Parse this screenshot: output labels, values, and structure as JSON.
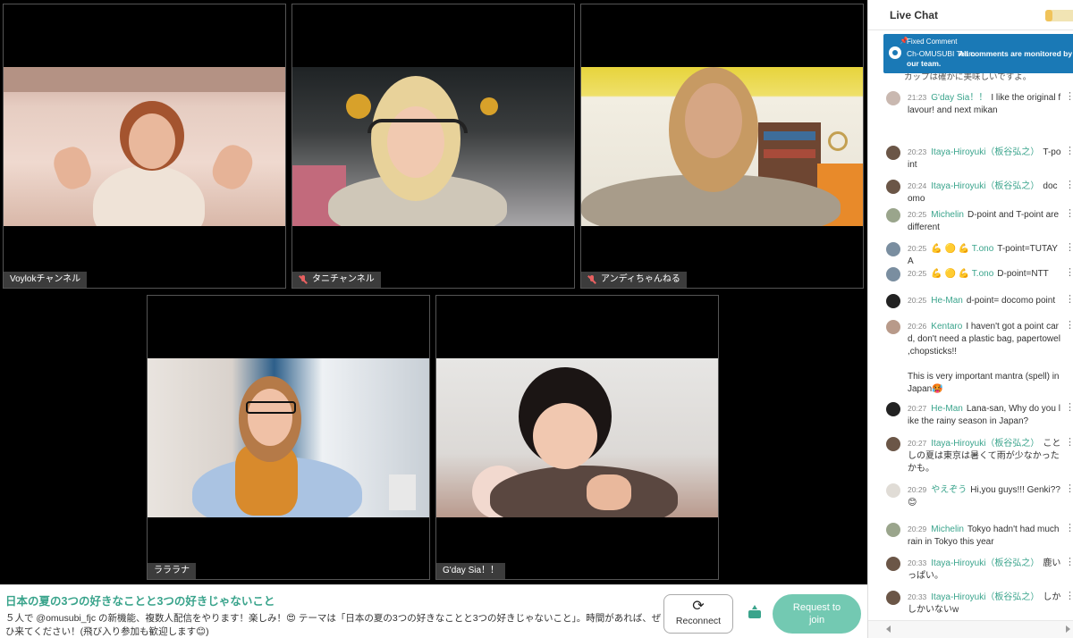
{
  "stage": {
    "tiles": [
      {
        "name": "Voylokチャンネル",
        "muted": false
      },
      {
        "name": "タニチャンネル",
        "muted": true
      },
      {
        "name": "アンディちゃんねる",
        "muted": true
      },
      {
        "name": "ラララナ",
        "muted": false
      },
      {
        "name": "G'day Sia！！",
        "muted": false
      }
    ]
  },
  "info": {
    "title": "日本の夏の3つの好きなことと3つの好きじゃないこと",
    "description": "５人で @omusubi_fjc の新機能、複数人配信をやります！楽しみ！😍 テーマは「日本の夏の3つの好きなことと3つの好きじゃないこと」。時間があれば、ぜひ来てください！(飛び入り参加も歓迎します😊)",
    "reconnect_label": "Reconnect",
    "join_label": "Request to join",
    "reconnect_icon": "refresh-icon",
    "share_icon": "share-icon"
  },
  "chat": {
    "title": "Live Chat",
    "pinned": {
      "label": "Fixed Comment",
      "author": "Ch-OMUSUBI Team",
      "text": "All comments are monitored by our team."
    },
    "ghost_text": "カップは確かに美味しいですよ。",
    "messages": [
      {
        "time": "21:23",
        "author": "G'day Sia！！",
        "text": "I like the original flavour! and next mikan",
        "avatar": "#c9b8b0"
      },
      {
        "time": "20:23",
        "author": "Itaya-Hiroyuki（板谷弘之）",
        "text": "T-point",
        "avatar": "#6b5647"
      },
      {
        "time": "20:24",
        "author": "Itaya-Hiroyuki（板谷弘之）",
        "text": "docomo",
        "avatar": "#6b5647"
      },
      {
        "time": "20:25",
        "author": "Michelin",
        "text": "D-point and T-point are different",
        "avatar": "#9aa58c"
      },
      {
        "time": "20:25",
        "author": "💪 🟡 💪 T.ono",
        "text": "T-point=TUTAYA",
        "avatar": "#7a8ea0"
      },
      {
        "time": "20:25",
        "author": "💪 🟡 💪 T.ono",
        "text": "D-point=NTT",
        "avatar": "#7a8ea0"
      },
      {
        "time": "20:25",
        "author": "He-Man",
        "text": "d-point= docomo point",
        "avatar": "#222222"
      },
      {
        "time": "20:26",
        "author": "Kentaro",
        "text": "I haven't got a point card, don't need a plastic bag, papertowel ,chopsticks!!",
        "text2": "This is very important mantra (spell) in Japan🥵",
        "avatar": "#b89a8a"
      },
      {
        "time": "20:27",
        "author": "He-Man",
        "text": "Lana-san, Why do you like the rainy season in Japan?",
        "avatar": "#222222"
      },
      {
        "time": "20:27",
        "author": "Itaya-Hiroyuki（板谷弘之）",
        "text": "ことしの夏は東京は暑くて雨が少なかったかも。",
        "avatar": "#6b5647"
      },
      {
        "time": "20:29",
        "author": "やえぞう",
        "text": "Hi,you guys!!! Genki??😊",
        "avatar": "#e0dcd6"
      },
      {
        "time": "20:29",
        "author": "Michelin",
        "text": "Tokyo hadn't had much rain in Tokyo this year",
        "avatar": "#9aa58c"
      },
      {
        "time": "20:33",
        "author": "Itaya-Hiroyuki（板谷弘之）",
        "text": "鹿いっぱい。",
        "avatar": "#6b5647"
      },
      {
        "time": "20:33",
        "author": "Itaya-Hiroyuki（板谷弘之）",
        "text": "しかしかいないw",
        "avatar": "#6b5647"
      }
    ]
  },
  "colors": {
    "accent": "#3aa48c",
    "join_button": "#73c9b2",
    "pinned_bg": "#1a79b6"
  }
}
